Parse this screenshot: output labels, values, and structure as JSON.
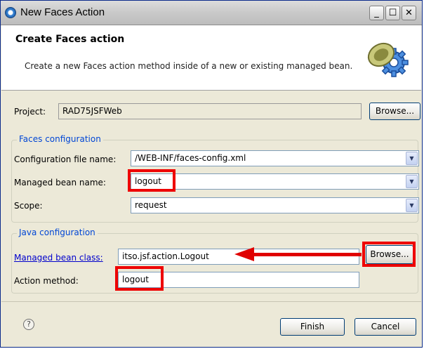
{
  "window": {
    "title": "New Faces Action",
    "minimize_glyph": "_",
    "maximize_glyph": "☐",
    "close_glyph": "✕"
  },
  "header": {
    "title": "Create Faces action",
    "description": "Create a new Faces action method inside of a new or existing managed bean.",
    "graphic_icon": "bean-gear-icon"
  },
  "project": {
    "label": "Project:",
    "value": "RAD75JSFWeb",
    "browse_label": "Browse..."
  },
  "faces_configuration": {
    "group_title": "Faces configuration",
    "config_file": {
      "label": "Configuration file name:",
      "value": "/WEB-INF/faces-config.xml"
    },
    "managed_bean": {
      "label": "Managed bean name:",
      "value": "logout"
    },
    "scope": {
      "label": "Scope:",
      "value": "request"
    }
  },
  "java_configuration": {
    "group_title": "Java configuration",
    "bean_class": {
      "label": "Managed bean class:",
      "value": "itso.jsf.action.Logout",
      "browse_label": "Browse..."
    },
    "action_method": {
      "label": "Action method:",
      "value": "logout"
    }
  },
  "footer": {
    "help_glyph": "?",
    "finish_label": "Finish",
    "cancel_label": "Cancel"
  },
  "colors": {
    "highlight": "#ee0000",
    "group_title": "#0046d5",
    "link": "#0000cc",
    "window_bg": "#ece9d8"
  }
}
